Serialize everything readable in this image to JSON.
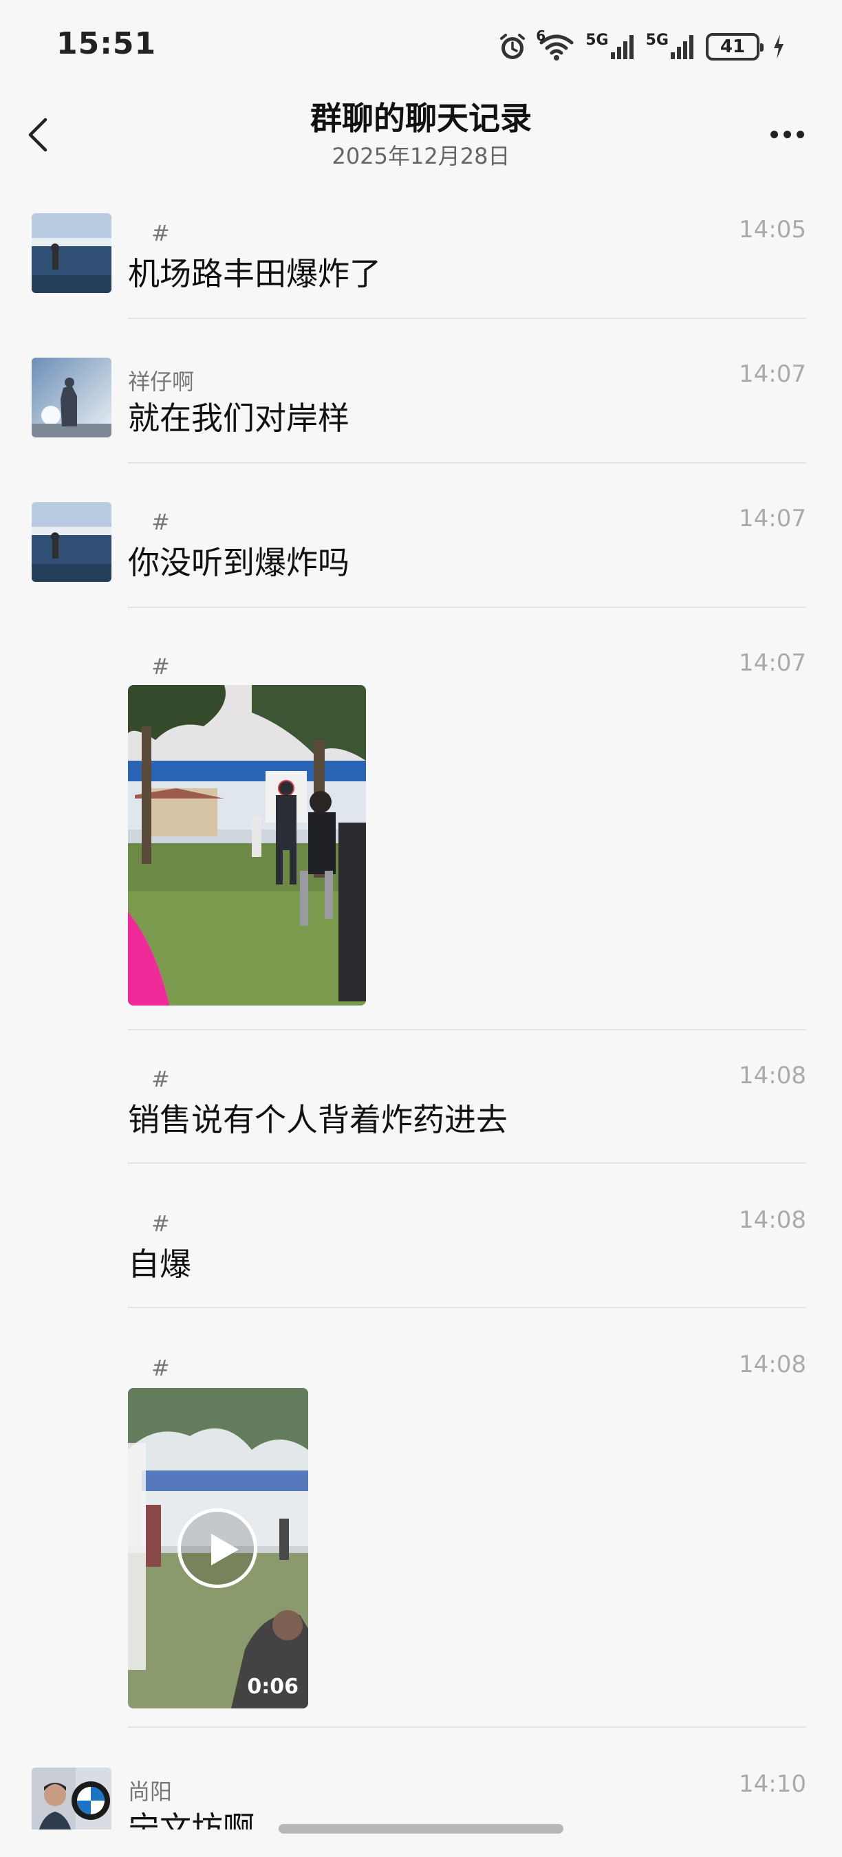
{
  "status_bar": {
    "time": "15:51",
    "net1": "5G",
    "net2": "5G",
    "wifi_sup": "6",
    "battery": "41"
  },
  "header": {
    "title": "群聊的聊天记录",
    "subtitle": "2025年12月28日"
  },
  "messages": [
    {
      "sender": "#",
      "time": "14:05",
      "text": "机场路丰田爆炸了"
    },
    {
      "sender": "祥仔啊",
      "time": "14:07",
      "text": "就在我们对岸样"
    },
    {
      "sender": "#",
      "time": "14:07",
      "text": "你没听到爆炸吗"
    },
    {
      "sender": "#",
      "time": "14:07",
      "type": "image"
    },
    {
      "sender": "#",
      "time": "14:08",
      "text": "销售说有个人背着炸药进去"
    },
    {
      "sender": "#",
      "time": "14:08",
      "text": "自爆"
    },
    {
      "sender": "#",
      "time": "14:08",
      "type": "video",
      "duration": "0:06"
    },
    {
      "sender": "尚阳",
      "time": "14:10",
      "text": "宁文坊啊"
    }
  ],
  "colors": {
    "background": "#f7f7f7",
    "divider": "#e4e4e4",
    "meta_text": "#aaaaaa"
  }
}
